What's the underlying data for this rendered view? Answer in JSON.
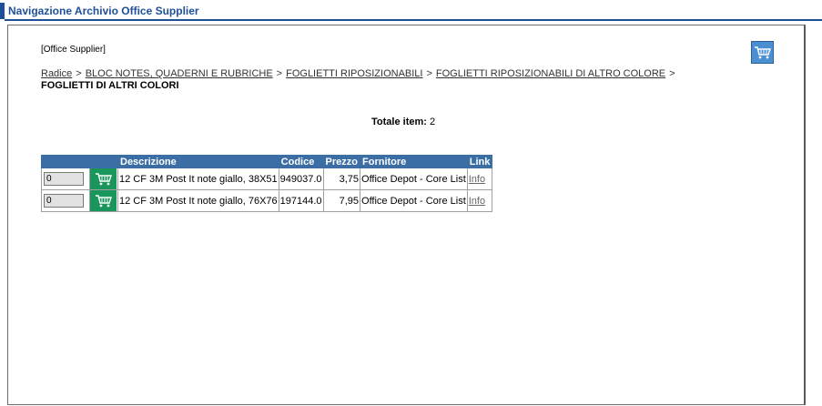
{
  "window": {
    "title": "Navigazione Archivio Office Supplier"
  },
  "supplier_label": "[Office Supplier]",
  "breadcrumb": {
    "root": "Radice",
    "items": [
      "BLOC NOTES, QUADERNI E RUBRICHE",
      "FOGLIETTI RIPOSIZIONABILI",
      "FOGLIETTI RIPOSIZIONABILI DI ALTRO COLORE"
    ],
    "current": "FOGLIETTI DI ALTRI COLORI",
    "separator": ">"
  },
  "totals": {
    "label": "Totale item:",
    "value": "2"
  },
  "table": {
    "headers": {
      "qty": "",
      "cart": "",
      "descrizione": "Descrizione",
      "codice": "Codice",
      "prezzo": "Prezzo",
      "fornitore": "Fornitore",
      "link": "Link"
    },
    "rows": [
      {
        "qty": "0",
        "descrizione": "12 CF 3M Post It note giallo, 38X51",
        "codice": "949037.0",
        "prezzo": "3,75",
        "fornitore": "Office Depot - Core List",
        "link": "Info"
      },
      {
        "qty": "0",
        "descrizione": "12 CF 3M Post It note giallo, 76X76",
        "codice": "197144.0",
        "prezzo": "7,95",
        "fornitore": "Office Depot - Core List",
        "link": "Info"
      }
    ]
  },
  "icons": {
    "cart": "shopping-cart-icon"
  },
  "colors": {
    "title": "#1f4f99",
    "header_bg": "#3a6ea5",
    "cart_button": "#18965c",
    "cart_top": "#4a8fd1"
  }
}
